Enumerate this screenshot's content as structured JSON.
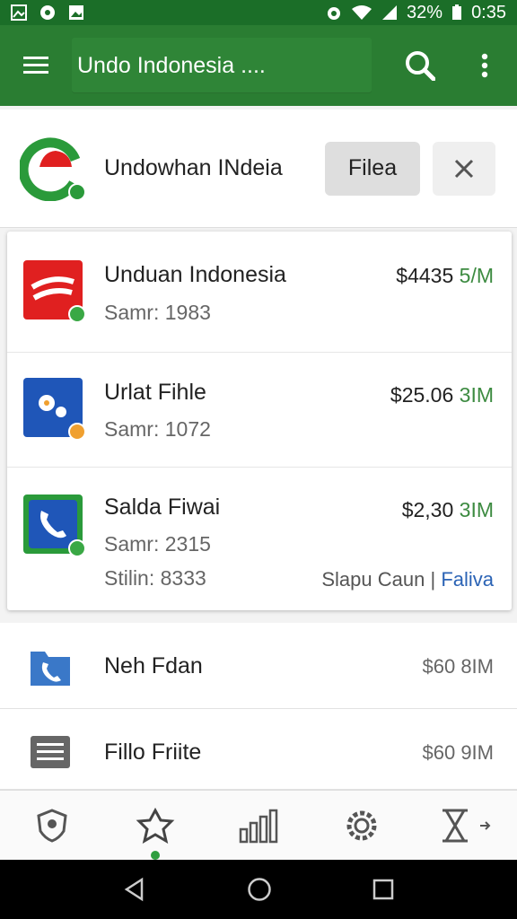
{
  "status_bar": {
    "battery": "32%",
    "time": "0:35",
    "icons": [
      "image-icon",
      "circle-icon",
      "photo-icon",
      "alarm-icon",
      "wifi-icon",
      "signal-icon",
      "battery-icon"
    ]
  },
  "app_bar": {
    "search_text": "Undo  Indonesia ....",
    "icons": [
      "menu-icon",
      "search-icon",
      "more-vert-icon"
    ]
  },
  "header": {
    "title": "Undowhan INdeia",
    "files_button": "Filea",
    "close_icon": "close-icon"
  },
  "list": [
    {
      "title": "Unduan Indonesia",
      "subtitle": "Samr: 1983",
      "price": "$4435",
      "size": "5/M",
      "icon": "app-red-icon",
      "icon_color": "#e02020",
      "badge_color": "#3aa845"
    },
    {
      "title": "Urlat Fihle",
      "subtitle": "Samr: 1072",
      "price": "$25.06",
      "size": "3IM",
      "icon": "flower-app-icon",
      "icon_color": "#1f56b8",
      "badge_color": "#f0a030"
    },
    {
      "title": "Salda Fiwai",
      "subtitle": "Samr: 2315",
      "subtitle2": "Stilin: 8333",
      "price": "$2,30",
      "size": "3IM",
      "link_prefix": "Slapu Caun |",
      "link": "Faliva",
      "icon": "phone-app-icon",
      "icon_color": "#2a9a3a",
      "badge_color": "#3aa845"
    }
  ],
  "plain_rows": [
    {
      "title": "Neh Fdan",
      "size": "$60 8IM",
      "icon": "phone-folder-icon"
    },
    {
      "title": "Fillo Friite",
      "size": "$60 9IM",
      "icon": "list-icon"
    }
  ],
  "bottom_nav": {
    "items": [
      "shield-icon",
      "star-icon",
      "bar-chart-icon",
      "gear-icon",
      "hourglass-icon"
    ],
    "active_index": 1
  },
  "system_nav": [
    "back-icon",
    "home-icon",
    "recents-icon"
  ],
  "colors": {
    "primary": "#2a7d32",
    "status": "#1b6e28",
    "accent": "#3d8b41",
    "link": "#2b63b5"
  }
}
